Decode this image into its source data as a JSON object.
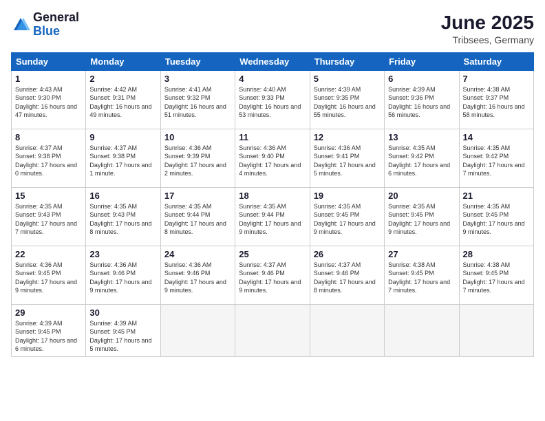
{
  "logo": {
    "general": "General",
    "blue": "Blue"
  },
  "title": "June 2025",
  "location": "Tribsees, Germany",
  "headers": [
    "Sunday",
    "Monday",
    "Tuesday",
    "Wednesday",
    "Thursday",
    "Friday",
    "Saturday"
  ],
  "days": [
    {
      "num": "1",
      "rise": "4:43 AM",
      "set": "9:30 PM",
      "daylight": "16 hours and 47 minutes."
    },
    {
      "num": "2",
      "rise": "4:42 AM",
      "set": "9:31 PM",
      "daylight": "16 hours and 49 minutes."
    },
    {
      "num": "3",
      "rise": "4:41 AM",
      "set": "9:32 PM",
      "daylight": "16 hours and 51 minutes."
    },
    {
      "num": "4",
      "rise": "4:40 AM",
      "set": "9:33 PM",
      "daylight": "16 hours and 53 minutes."
    },
    {
      "num": "5",
      "rise": "4:39 AM",
      "set": "9:35 PM",
      "daylight": "16 hours and 55 minutes."
    },
    {
      "num": "6",
      "rise": "4:39 AM",
      "set": "9:36 PM",
      "daylight": "16 hours and 56 minutes."
    },
    {
      "num": "7",
      "rise": "4:38 AM",
      "set": "9:37 PM",
      "daylight": "16 hours and 58 minutes."
    },
    {
      "num": "8",
      "rise": "4:37 AM",
      "set": "9:38 PM",
      "daylight": "17 hours and 0 minutes."
    },
    {
      "num": "9",
      "rise": "4:37 AM",
      "set": "9:38 PM",
      "daylight": "17 hours and 1 minute."
    },
    {
      "num": "10",
      "rise": "4:36 AM",
      "set": "9:39 PM",
      "daylight": "17 hours and 2 minutes."
    },
    {
      "num": "11",
      "rise": "4:36 AM",
      "set": "9:40 PM",
      "daylight": "17 hours and 4 minutes."
    },
    {
      "num": "12",
      "rise": "4:36 AM",
      "set": "9:41 PM",
      "daylight": "17 hours and 5 minutes."
    },
    {
      "num": "13",
      "rise": "4:35 AM",
      "set": "9:42 PM",
      "daylight": "17 hours and 6 minutes."
    },
    {
      "num": "14",
      "rise": "4:35 AM",
      "set": "9:42 PM",
      "daylight": "17 hours and 7 minutes."
    },
    {
      "num": "15",
      "rise": "4:35 AM",
      "set": "9:43 PM",
      "daylight": "17 hours and 7 minutes."
    },
    {
      "num": "16",
      "rise": "4:35 AM",
      "set": "9:43 PM",
      "daylight": "17 hours and 8 minutes."
    },
    {
      "num": "17",
      "rise": "4:35 AM",
      "set": "9:44 PM",
      "daylight": "17 hours and 8 minutes."
    },
    {
      "num": "18",
      "rise": "4:35 AM",
      "set": "9:44 PM",
      "daylight": "17 hours and 9 minutes."
    },
    {
      "num": "19",
      "rise": "4:35 AM",
      "set": "9:45 PM",
      "daylight": "17 hours and 9 minutes."
    },
    {
      "num": "20",
      "rise": "4:35 AM",
      "set": "9:45 PM",
      "daylight": "17 hours and 9 minutes."
    },
    {
      "num": "21",
      "rise": "4:35 AM",
      "set": "9:45 PM",
      "daylight": "17 hours and 9 minutes."
    },
    {
      "num": "22",
      "rise": "4:36 AM",
      "set": "9:45 PM",
      "daylight": "17 hours and 9 minutes."
    },
    {
      "num": "23",
      "rise": "4:36 AM",
      "set": "9:46 PM",
      "daylight": "17 hours and 9 minutes."
    },
    {
      "num": "24",
      "rise": "4:36 AM",
      "set": "9:46 PM",
      "daylight": "17 hours and 9 minutes."
    },
    {
      "num": "25",
      "rise": "4:37 AM",
      "set": "9:46 PM",
      "daylight": "17 hours and 9 minutes."
    },
    {
      "num": "26",
      "rise": "4:37 AM",
      "set": "9:46 PM",
      "daylight": "17 hours and 8 minutes."
    },
    {
      "num": "27",
      "rise": "4:38 AM",
      "set": "9:45 PM",
      "daylight": "17 hours and 7 minutes."
    },
    {
      "num": "28",
      "rise": "4:38 AM",
      "set": "9:45 PM",
      "daylight": "17 hours and 7 minutes."
    },
    {
      "num": "29",
      "rise": "4:39 AM",
      "set": "9:45 PM",
      "daylight": "17 hours and 6 minutes."
    },
    {
      "num": "30",
      "rise": "4:39 AM",
      "set": "9:45 PM",
      "daylight": "17 hours and 5 minutes."
    }
  ]
}
